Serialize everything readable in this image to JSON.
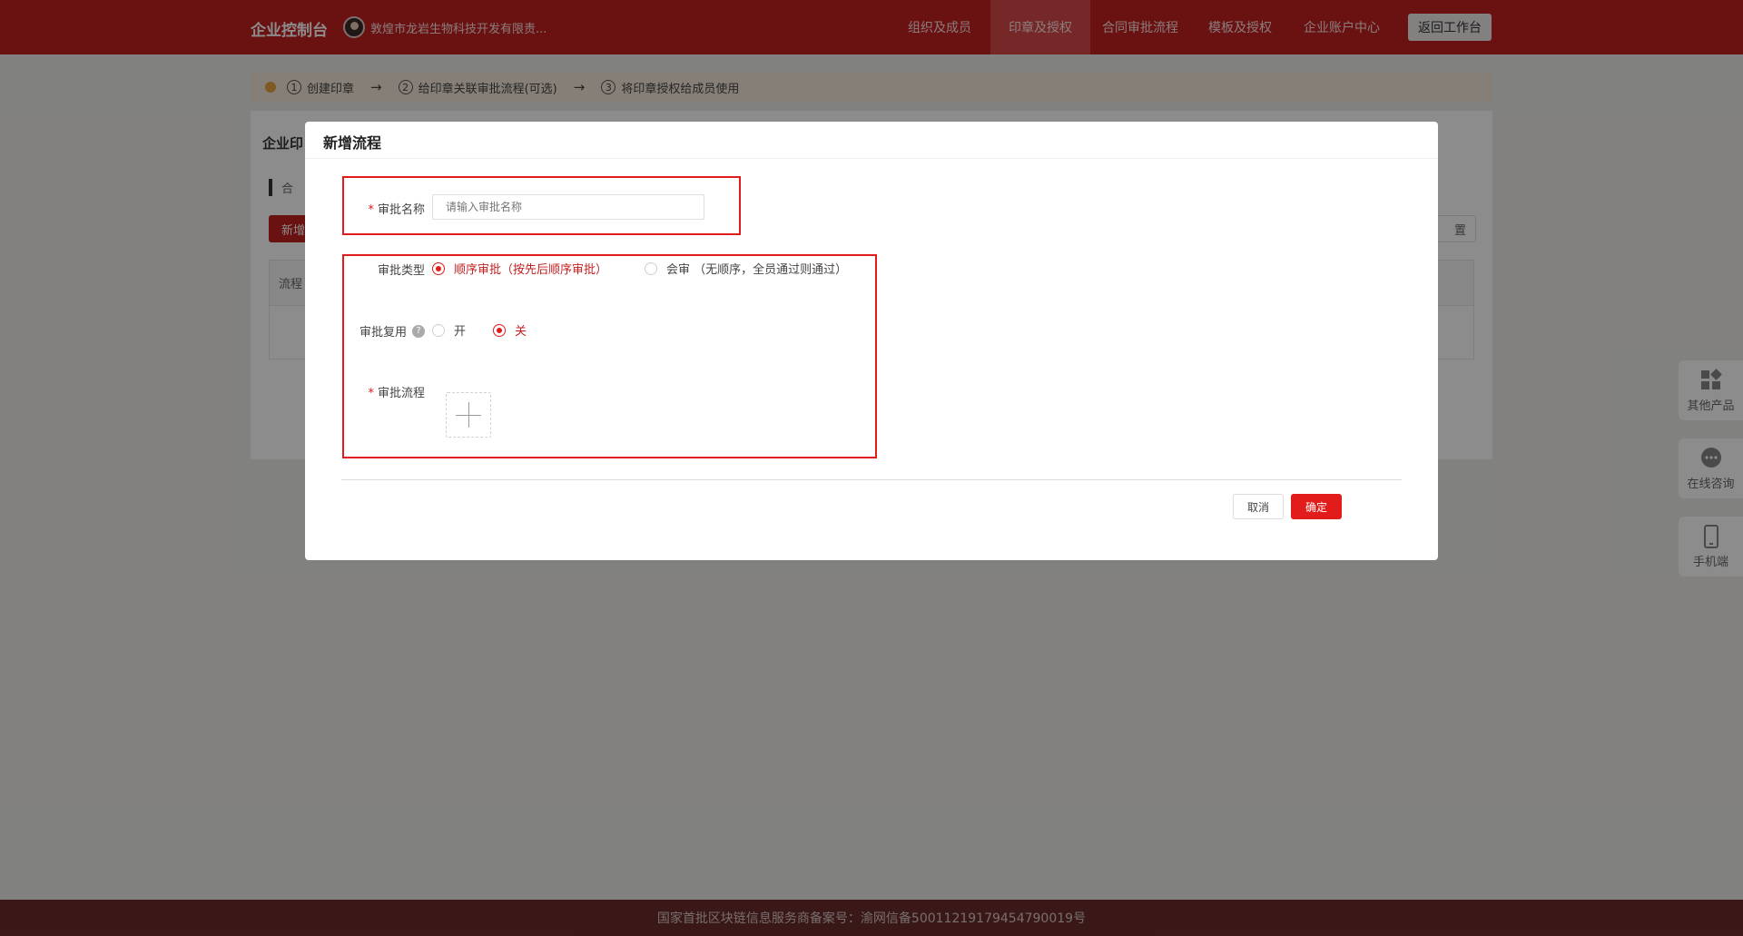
{
  "topbar": {
    "brand": "企业控制台",
    "company": "敦煌市龙岩生物科技开发有限责...",
    "nav": [
      "组织及成员",
      "印章及授权",
      "合同审批流程",
      "模板及授权",
      "企业账户中心"
    ],
    "active_nav": "印章及授权",
    "back_label": "返回工作台",
    "accent": "#c21f1f"
  },
  "steps": {
    "items": [
      {
        "num": "1",
        "label": "创建印章"
      },
      {
        "num": "2",
        "label": "给印章关联审批流程(可选)"
      },
      {
        "num": "3",
        "label": "将印章授权给成员使用"
      }
    ]
  },
  "background": {
    "card_title": "企业印",
    "sub_title": "合",
    "new_button": "新增",
    "settings_button": "置",
    "table_header": "流程"
  },
  "modal": {
    "title": "新增流程",
    "name_label": "审批名称",
    "name_placeholder": "请输入审批名称",
    "type_label": "审批类型",
    "type_options": [
      "顺序审批（按先后顺序审批）",
      "会审 （无顺序，全员通过则通过）"
    ],
    "type_selected": "顺序审批（按先后顺序审批）",
    "reuse_label": "审批复用",
    "reuse_options": [
      "开",
      "关"
    ],
    "reuse_selected": "关",
    "flow_label": "审批流程",
    "cancel_label": "取消",
    "ok_label": "确定",
    "highlight_color": "#e21b1b"
  },
  "side_widgets": [
    "其他产品",
    "在线咨询",
    "手机端"
  ],
  "footer": "国家首批区块链信息服务商备案号：渝网信备50011219179454790019号"
}
